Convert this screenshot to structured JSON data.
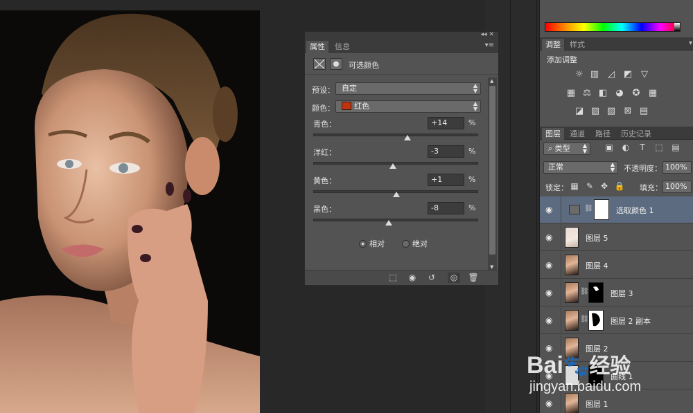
{
  "properties_panel": {
    "top_controls": "◂◂  ✕",
    "tabs": [
      "属性",
      "信息"
    ],
    "menu_icon": "▾≡",
    "title": "可选颜色",
    "preset_label": "预设：",
    "preset_value": "自定",
    "color_label": "颜色：",
    "color_value": "红色",
    "color_swatch": "#c0330f",
    "sliders": [
      {
        "label": "青色：",
        "value": "+14",
        "unit": "%",
        "position": 57
      },
      {
        "label": "洋红：",
        "value": "-3",
        "unit": "%",
        "position": 48.5
      },
      {
        "label": "黄色：",
        "value": "+1",
        "unit": "%",
        "position": 50.5
      },
      {
        "label": "黑色：",
        "value": "-8",
        "unit": "%",
        "position": 46
      }
    ],
    "radio_relative": "相对",
    "radio_absolute": "绝对",
    "radio_selected": "相对"
  },
  "adjustments_panel": {
    "tabs": [
      "调整",
      "样式"
    ],
    "label": "添加调整"
  },
  "layers_panel": {
    "tabs": [
      "图层",
      "通道",
      "路径",
      "历史记录"
    ],
    "filter_type": "类型",
    "blend_mode": "正常",
    "opacity_label": "不透明度：",
    "opacity_value": "100%",
    "lock_label": "锁定：",
    "fill_label": "填充：",
    "fill_value": "100%",
    "layers": [
      {
        "name": "选取颜色 1",
        "selected": true
      },
      {
        "name": "图层 5"
      },
      {
        "name": "图层 4"
      },
      {
        "name": "图层 3"
      },
      {
        "name": "图层 2 副本"
      },
      {
        "name": "图层 2"
      },
      {
        "name": "曲线 1"
      },
      {
        "name": "图层 1"
      }
    ]
  },
  "watermark": {
    "brand": "Bai",
    "brand_suffix": "经验",
    "url": "jingyan.baidu.com"
  },
  "colors": {
    "panel_bg": "#535353",
    "selected_row": "#5d6b80",
    "accent_swatch": "#c0330f"
  }
}
